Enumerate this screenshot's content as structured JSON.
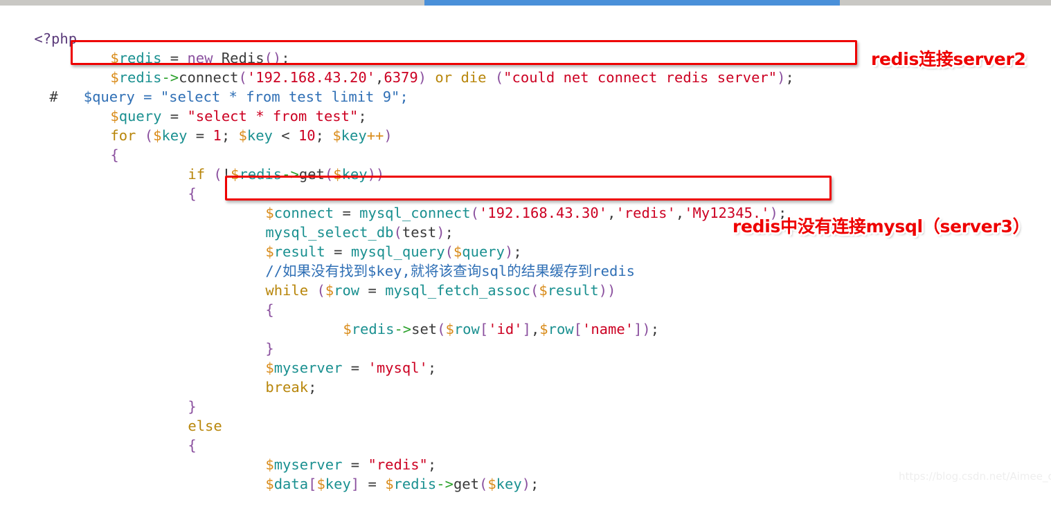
{
  "window": {
    "top_bar": {
      "track_color": "#c9c8c4",
      "progress_color": "#4a90d9"
    }
  },
  "editor": {
    "language": "php",
    "background_color": "#ffffff",
    "default_text_color": "#3a3a3a",
    "font_size_px": 20.5,
    "line_height_px": 28,
    "lines": [
      {
        "indent": 0,
        "text": "<?php"
      },
      {
        "indent": 0,
        "text": "        $redis = new Redis();"
      },
      {
        "indent": 0,
        "text": "        $redis->connect('192.168.43.20',6379) or die (\"could net connect redis server\");"
      },
      {
        "indent": 0,
        "text": "#        $query = \"select * from test limit 9\";"
      },
      {
        "indent": 0,
        "text": "        $query = \"select * from test\";"
      },
      {
        "indent": 0,
        "text": "        for ($key = 1; $key < 10; $key++)"
      },
      {
        "indent": 0,
        "text": "        {"
      },
      {
        "indent": 0,
        "text": "                if (!$redis->get($key))"
      },
      {
        "indent": 0,
        "text": "                {"
      },
      {
        "indent": 0,
        "text": "                        $connect = mysql_connect('192.168.43.30','redis','My12345.');"
      },
      {
        "indent": 0,
        "text": "                        mysql_select_db(test);"
      },
      {
        "indent": 0,
        "text": "                        $result = mysql_query($query);"
      },
      {
        "indent": 0,
        "text": "                        //如果没有找到$key,就将该查询sql的结果缓存到redis"
      },
      {
        "indent": 0,
        "text": "                        while ($row = mysql_fetch_assoc($result))"
      },
      {
        "indent": 0,
        "text": "                        {"
      },
      {
        "indent": 0,
        "text": "                                $redis->set($row['id'],$row['name']);"
      },
      {
        "indent": 0,
        "text": "                        }"
      },
      {
        "indent": 0,
        "text": "                        $myserver = 'mysql';"
      },
      {
        "indent": 0,
        "text": "                        break;"
      },
      {
        "indent": 0,
        "text": "                }"
      },
      {
        "indent": 0,
        "text": "                else"
      },
      {
        "indent": 0,
        "text": "                {"
      },
      {
        "indent": 0,
        "text": "                        $myserver = \"redis\";"
      },
      {
        "indent": 0,
        "text": "                        $data[$key] = $redis->get($key);"
      }
    ],
    "tokens": {
      "php_open_tag": "<?php",
      "var_redis": "redis",
      "var_query": "query",
      "var_key": "key",
      "var_connect": "connect",
      "var_result": "result",
      "var_row": "row",
      "var_myserver": "myserver",
      "var_data": "data",
      "redis_host": "'192.168.43.20'",
      "redis_port": "6379",
      "die_message": "\"could net connect redis server\"",
      "mysql_host": "'192.168.43.30'",
      "mysql_user": "'redis'",
      "mysql_password": "'My12345.'",
      "sql_query_commented": "\"select * from test limit 9\"",
      "sql_query": "\"select * from test\"",
      "comment_chinese": "//如果没有找到$key,就将该查询sql的结果缓存到redis",
      "myserver_mysql": "'mysql'",
      "myserver_redis": "\"redis\"",
      "row_id": "'id'",
      "row_name": "'name'"
    },
    "colors": {
      "variable": "#1a9090",
      "sigil": "#d98b19",
      "keyword": "#b8860b",
      "keyword_new": "#8a4f9e",
      "string": "#cc0022",
      "number": "#cc0022",
      "function": "#3a3a3a",
      "punctuation": "#8a4f9e",
      "arrow": "#2aa02a",
      "comment": "#2f6fb5",
      "tag": "#5a3a7a"
    }
  },
  "highlights": {
    "boxes": [
      {
        "name": "redis-connect-line",
        "color": "#ee0000"
      },
      {
        "name": "mysql-connect-line",
        "color": "#ee0000"
      }
    ]
  },
  "annotations": [
    {
      "id": "redis-server2",
      "text": "redis连接server2",
      "color": "#ee0000"
    },
    {
      "id": "no-mysql-in-redis",
      "text": "redis中没有连接mysql（server3）",
      "color": "#ee0000"
    }
  ],
  "watermark": {
    "text": "https://blog.csdn.net/Aimee_c",
    "color": "#eeeeee"
  }
}
